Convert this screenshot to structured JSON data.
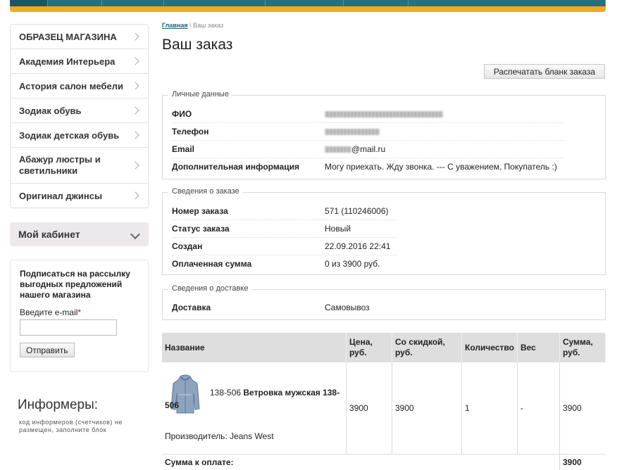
{
  "sidebar": {
    "categories": [
      {
        "label": "ОБРАЗЕЦ МАГАЗИНА"
      },
      {
        "label": "Академия Интерьера"
      },
      {
        "label": "Астория салон мебели"
      },
      {
        "label": "Зодиак обувь"
      },
      {
        "label": "Зодиак детская обувь"
      },
      {
        "label": "Абажур люстры и светильники"
      },
      {
        "label": "Оригинал джинсы"
      }
    ],
    "cabinet_label": "Мой кабинет",
    "subscribe": {
      "title": "Подписаться на рассылку выгодных предложений нашего магазина",
      "email_label": "Введите e-mail",
      "required_mark": "*",
      "email_value": "",
      "submit_label": "Отправить"
    },
    "informers_title": "Информеры:",
    "informers_note": "код информеров (счетчиков) не размещен, заполните блок"
  },
  "breadcrumb": {
    "home": "Главная",
    "separator": "\\",
    "current": "Ваш заказ"
  },
  "page_title": "Ваш заказ",
  "print_button": "Распечатать бланк заказа",
  "personal": {
    "legend": "Личные данные",
    "rows": [
      {
        "key": "ФИО",
        "value": ""
      },
      {
        "key": "Телефон",
        "value": ""
      },
      {
        "key": "Email",
        "value": "@mail.ru"
      },
      {
        "key": "Дополнительная информация",
        "value": "Могу приехать. Жду звонка. --- С уважением, Покупатель :)"
      }
    ]
  },
  "order": {
    "legend": "Сведения о заказе",
    "rows": [
      {
        "key": "Номер заказа",
        "value": "571 (110246006)"
      },
      {
        "key": "Статус заказа",
        "value": "Новый"
      },
      {
        "key": "Создан",
        "value": "22.09.2016 22:41"
      },
      {
        "key": "Оплаченная сумма",
        "value": "0 из 3900 руб."
      }
    ]
  },
  "delivery": {
    "legend": "Сведения о доставке",
    "rows": [
      {
        "key": "Доставка",
        "value": "Самовывоз"
      }
    ]
  },
  "table": {
    "headers": [
      "Название",
      "Цена, руб.",
      "Со скидкой, руб.",
      "Количество",
      "Вес",
      "Сумма, руб."
    ],
    "items": [
      {
        "article": "138-506",
        "name": "Ветровка мужская 138-506",
        "maker": "Производитель: Jeans West",
        "price": "3900",
        "discount_price": "3900",
        "qty": "1",
        "weight": "-",
        "sum": "3900"
      }
    ],
    "total_label": "Сумма к оплате:",
    "total_value": "3900"
  },
  "colors": {
    "accent": "#f2a91b",
    "nav": "#2a6e82",
    "link": "#1f6078"
  }
}
